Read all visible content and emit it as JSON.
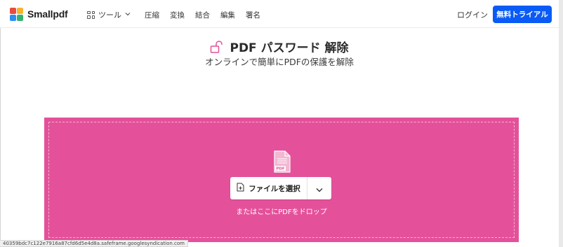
{
  "brand": {
    "name": "Smallpdf",
    "logo_colors": [
      "#e84c3d",
      "#f6b42c",
      "#2c8ef3",
      "#37b26c"
    ]
  },
  "nav": {
    "tools_label": "ツール",
    "links": [
      "圧縮",
      "変換",
      "結合",
      "編集",
      "署名"
    ]
  },
  "header": {
    "login_label": "ログイン",
    "trial_label": "無料トライアル"
  },
  "page": {
    "title": "PDF パスワード 解除",
    "subtitle": "オンラインで簡単にPDFの保護を解除"
  },
  "dropzone": {
    "choose_label": "ファイルを選択",
    "hint": "またはここにPDFをドロップ",
    "file_icon_label": "PDF",
    "color": "#e4519a"
  },
  "status_bar": {
    "url": "40359bdc7c122e7916a87cfd6d5e4d8a.safeframe.googlesyndication.com"
  },
  "colors": {
    "accent": "#0a5bf5",
    "dropzone": "#e4519a"
  }
}
